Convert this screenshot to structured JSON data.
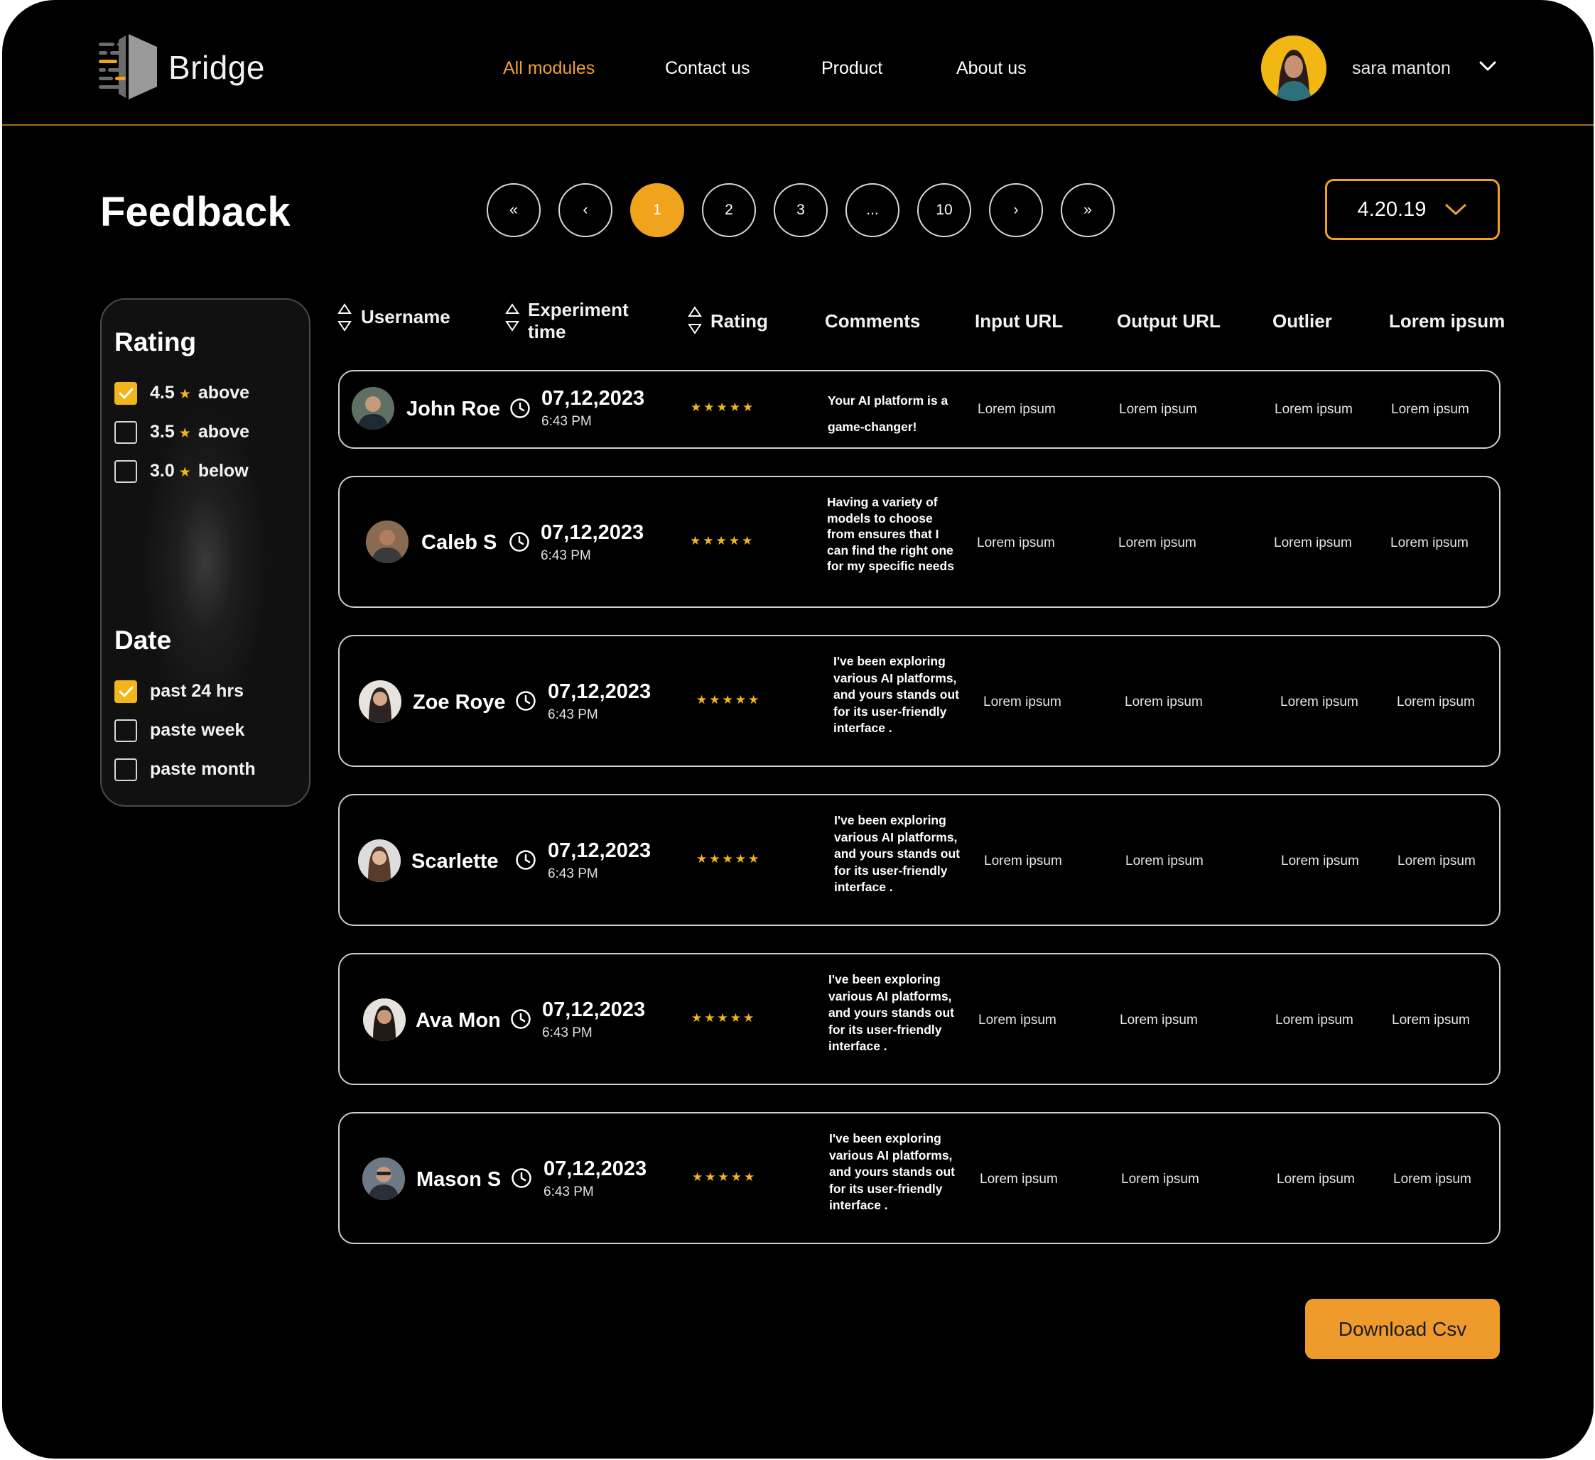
{
  "brand": {
    "name": "Bridge"
  },
  "nav": [
    {
      "label": "All modules",
      "active": true
    },
    {
      "label": "Contact us",
      "active": false
    },
    {
      "label": "Product",
      "active": false
    },
    {
      "label": "About us",
      "active": false
    }
  ],
  "user": {
    "name": "sara manton",
    "avatar_icon": "user-avatar",
    "menu_icon": "chevron-down-icon"
  },
  "page": {
    "title": "Feedback"
  },
  "pagination": {
    "items": [
      "«",
      "‹",
      "1",
      "2",
      "3",
      "...",
      "10",
      "›",
      "»"
    ],
    "current": "1"
  },
  "version": {
    "value": "4.20.19",
    "icon": "chevron-down-icon"
  },
  "filters": {
    "rating": {
      "title": "Rating",
      "options": [
        {
          "value": "4.5",
          "qualifier": "above",
          "checked": true
        },
        {
          "value": "3.5",
          "qualifier": "above",
          "checked": false
        },
        {
          "value": "3.0",
          "qualifier": "below",
          "checked": false
        }
      ]
    },
    "date": {
      "title": "Date",
      "options": [
        {
          "label": "past 24 hrs",
          "checked": true
        },
        {
          "label": "paste week",
          "checked": false
        },
        {
          "label": "paste month",
          "checked": false
        }
      ]
    }
  },
  "table": {
    "columns": {
      "username": "Username",
      "experiment_line1": "Experiment",
      "experiment_line2": "time",
      "rating": "Rating",
      "comments": "Comments",
      "input_url": "Input URL",
      "output_url": "Output URL",
      "outlier": "Outlier",
      "lorem": "Lorem ipsum"
    },
    "rows": [
      {
        "username": "John Roe",
        "date": "07,12,2023",
        "time": "6:43 PM",
        "stars": "★★★★★",
        "comment": "Your AI platform is a game-changer!",
        "input_url": "Lorem ipsum",
        "output_url": "Lorem ipsum",
        "outlier": "Lorem ipsum",
        "lorem": "Lorem ipsum"
      },
      {
        "username": "Caleb S",
        "date": "07,12,2023",
        "time": "6:43 PM",
        "stars": "★★★★★",
        "comment": "Having a variety of models to choose from ensures that I can find the right one for my specific needs",
        "input_url": "Lorem ipsum",
        "output_url": "Lorem ipsum",
        "outlier": "Lorem ipsum",
        "lorem": "Lorem ipsum"
      },
      {
        "username": "Zoe Roye",
        "date": "07,12,2023",
        "time": "6:43 PM",
        "stars": "★★★★★",
        "comment": "I've been exploring various AI platforms, and yours stands out for its user-friendly interface .",
        "input_url": "Lorem ipsum",
        "output_url": "Lorem ipsum",
        "outlier": "Lorem ipsum",
        "lorem": "Lorem ipsum"
      },
      {
        "username": "Scarlette",
        "date": "07,12,2023",
        "time": "6:43 PM",
        "stars": "★★★★★",
        "comment": "I've been exploring various AI platforms, and yours stands out for its user-friendly interface .",
        "input_url": "Lorem ipsum",
        "output_url": "Lorem ipsum",
        "outlier": "Lorem ipsum",
        "lorem": "Lorem ipsum"
      },
      {
        "username": "Ava Mon",
        "date": "07,12,2023",
        "time": "6:43 PM",
        "stars": "★★★★★",
        "comment": "I've been exploring various AI platforms, and yours stands out for its user-friendly interface .",
        "input_url": "Lorem ipsum",
        "output_url": "Lorem ipsum",
        "outlier": "Lorem ipsum",
        "lorem": "Lorem ipsum"
      },
      {
        "username": "Mason S",
        "date": "07,12,2023",
        "time": "6:43 PM",
        "stars": "★★★★★",
        "comment": "I've been exploring various AI platforms, and yours stands out for its user-friendly interface .",
        "input_url": "Lorem ipsum",
        "output_url": "Lorem ipsum",
        "outlier": "Lorem ipsum",
        "lorem": "Lorem ipsum"
      }
    ]
  },
  "actions": {
    "download_label": "Download Csv"
  },
  "colors": {
    "accent": "#f0a31c",
    "background": "#000000",
    "divider": "#a56d18",
    "star": "#f2b61c",
    "button": "#ee9b2c"
  }
}
